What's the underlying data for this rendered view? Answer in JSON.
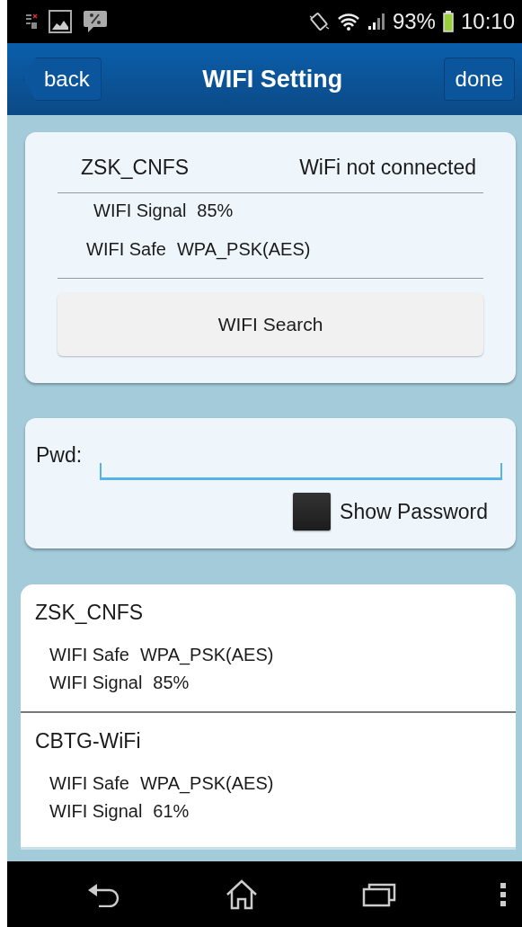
{
  "status_bar": {
    "battery": "93%",
    "time": "10:10"
  },
  "nav": {
    "back": "back",
    "title": "WIFI Setting",
    "done": "done"
  },
  "current": {
    "ssid": "ZSK_CNFS",
    "status": "WiFi not connected",
    "signal_label": "WIFI Signal",
    "signal": "85%",
    "safe_label": "WIFI Safe",
    "safe": "WPA_PSK(AES)",
    "search_button": "WIFI Search"
  },
  "password": {
    "label": "Pwd:",
    "show_password": {
      "label": "Show Password",
      "checked": false
    }
  },
  "networks": [
    {
      "ssid": "ZSK_CNFS",
      "safe_label": "WIFI Safe",
      "safe": "WPA_PSK(AES)",
      "signal_label": "WIFI Signal",
      "signal": "85%"
    },
    {
      "ssid": "CBTG-WiFi",
      "safe_label": "WIFI Safe",
      "safe": "WPA_PSK(AES)",
      "signal_label": "WIFI Signal",
      "signal": "61%"
    }
  ]
}
